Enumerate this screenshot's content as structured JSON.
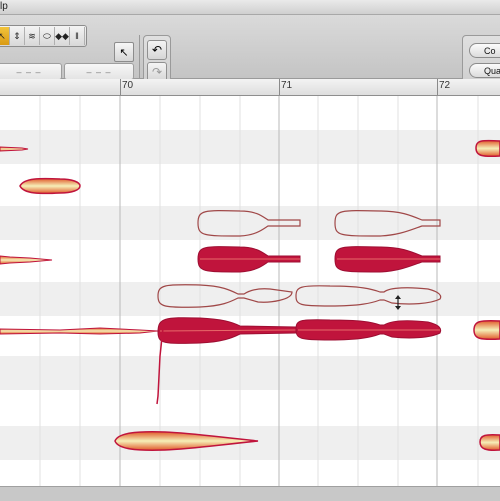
{
  "menubar": {
    "fragment": "lp"
  },
  "toolbar": {
    "tools": [
      {
        "name": "main-tool-icon",
        "glyph": "↖"
      },
      {
        "name": "pitch-tool-icon",
        "glyph": "⇕"
      },
      {
        "name": "formant-tool-icon",
        "glyph": "≋"
      },
      {
        "name": "amplitude-tool-icon",
        "glyph": "⬭"
      },
      {
        "name": "time-tool-icon",
        "glyph": "◆◆"
      },
      {
        "name": "separation-tool-icon",
        "glyph": "‖"
      }
    ],
    "field_left": "– – –",
    "field_right": "– – –",
    "undo_glyph": "↶",
    "redo_glyph": "↷",
    "right_btn_1": "Co",
    "right_btn_2": "Qua"
  },
  "ruler": {
    "bars": [
      "70",
      "71",
      "72"
    ]
  },
  "colors": {
    "blob_fill": "#c0143c",
    "blob_edge": "#b0103a",
    "blob_core": "#f4e39b",
    "outline": "#a05050"
  }
}
